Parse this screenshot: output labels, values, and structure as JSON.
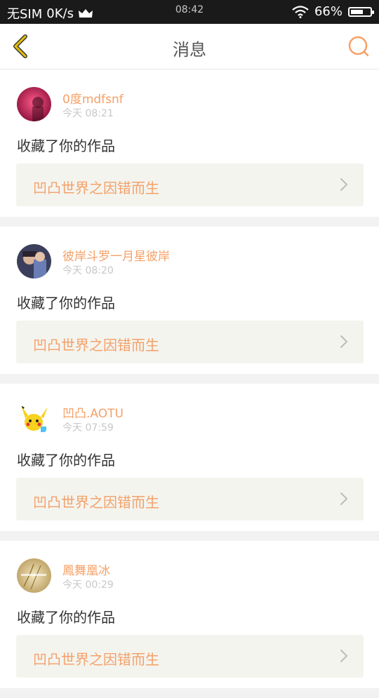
{
  "status_bar": {
    "carrier": "无SIM",
    "speed": "0K/s",
    "time": "08:42",
    "battery_percent": "66%",
    "battery_level": 0.66
  },
  "header": {
    "title": "消息"
  },
  "colors": {
    "accent": "#f5a066",
    "work_bg": "#f4f4ee",
    "back_icon": "#e0b400"
  },
  "messages": [
    {
      "name": "0度mdfsnf",
      "time": "今天 08:21",
      "action": "收藏了你的作品",
      "work": "凹凸世界之因错而生"
    },
    {
      "name": "彼岸斗罗一月星彼岸",
      "time": "今天 08:20",
      "action": "收藏了你的作品",
      "work": "凹凸世界之因错而生"
    },
    {
      "name": "凹凸.AOTU",
      "time": "今天 07:59",
      "action": "收藏了你的作品",
      "work": "凹凸世界之因错而生"
    },
    {
      "name": "鳳舞凰冰",
      "time": "今天 00:29",
      "action": "收藏了你的作品",
      "work": "凹凸世界之因错而生"
    }
  ]
}
